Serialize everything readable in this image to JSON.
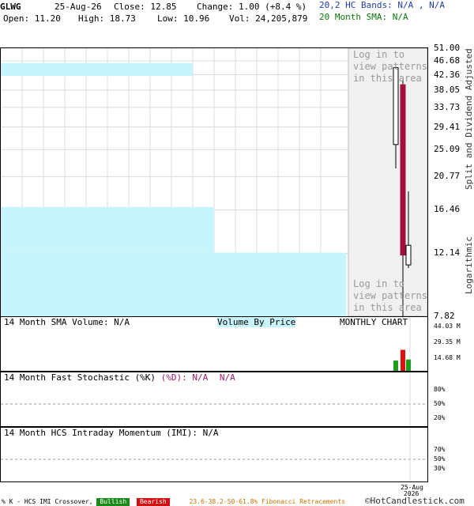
{
  "header": {
    "symbol": "GLWG",
    "date": "25-Aug-26",
    "close": "Close: 12.85",
    "change": "Change: 1.00 (+8.4 %)",
    "hc_bands": "20,2 HC Bands: N/A , N/A",
    "open": "Open: 11.20",
    "high": "High: 18.73",
    "low": "Low: 10.96",
    "vol": "Vol: 24,205,879",
    "sma20": "20 Month SMA: N/A"
  },
  "price_axis": {
    "ticks": [
      "51.00",
      "46.68",
      "42.36",
      "38.05",
      "33.73",
      "29.41",
      "25.09",
      "20.77",
      "16.46",
      "12.14",
      "7.82"
    ],
    "right_label_top": "Split and Dividend Adjusted",
    "right_label_bottom": "Logarithmic"
  },
  "login_message": "Log in to\nview patterns\nin this area",
  "volume_panel": {
    "label": "14 Month SMA Volume: N/A",
    "vbp": "Volume By Price",
    "chart_type": "MONTHLY CHART",
    "ticks": [
      "44.03 M",
      "29.35 M",
      "14.68 M"
    ]
  },
  "stoch_panel": {
    "label": "14 Month Fast Stochastic (%K)",
    "d_label": "(%D): N/A",
    "d_value": "N/A",
    "ticks": [
      "80%",
      "50%",
      "20%"
    ]
  },
  "imi_panel": {
    "label": "14 Month HCS Intraday Momentum (IMI): N/A",
    "ticks": [
      "70%",
      "50%",
      "30%"
    ]
  },
  "x_axis": {
    "label_month": "25-Aug",
    "label_year": "2026"
  },
  "footer": {
    "crossover": "% K - HCS IMI Crossover,",
    "bullish": "Bullish",
    "bearish": "Bearish",
    "fib": "23.6-38.2-50-61.8% Fibonacci Retracements",
    "copyright": "©HotCandlestick.com"
  },
  "colors": {
    "bull_up": "#ffffff",
    "bear_down": "#a0103a",
    "volume_up": "#1aa01a",
    "volume_down": "#e01010",
    "vbp": "#c8f4fc",
    "login_bg": "#f0f0f0"
  },
  "chart_data": {
    "type": "candlestick",
    "scale": "log",
    "ylim": [
      7.82,
      51.0
    ],
    "candles": [
      {
        "open": 26.0,
        "high": 44.8,
        "low": 22.0,
        "close": 44.5
      },
      {
        "open": 39.5,
        "high": 41.0,
        "low": 7.82,
        "close": 12.0
      },
      {
        "open": 11.2,
        "high": 18.73,
        "low": 10.96,
        "close": 12.85
      }
    ],
    "volume": {
      "ylim_millions": [
        0,
        44.03
      ],
      "values_millions": [
        9.5,
        19.5,
        10.5
      ],
      "colors": [
        "green",
        "red",
        "green"
      ]
    },
    "volume_by_price": [
      {
        "price_low": 42.0,
        "price_high": 46.0,
        "relative": 0.45
      },
      {
        "price_low": 16.8,
        "price_high": 12.2,
        "relative": 0.5
      },
      {
        "price_low": 12.2,
        "price_high": 7.82,
        "relative": 0.81
      }
    ]
  }
}
